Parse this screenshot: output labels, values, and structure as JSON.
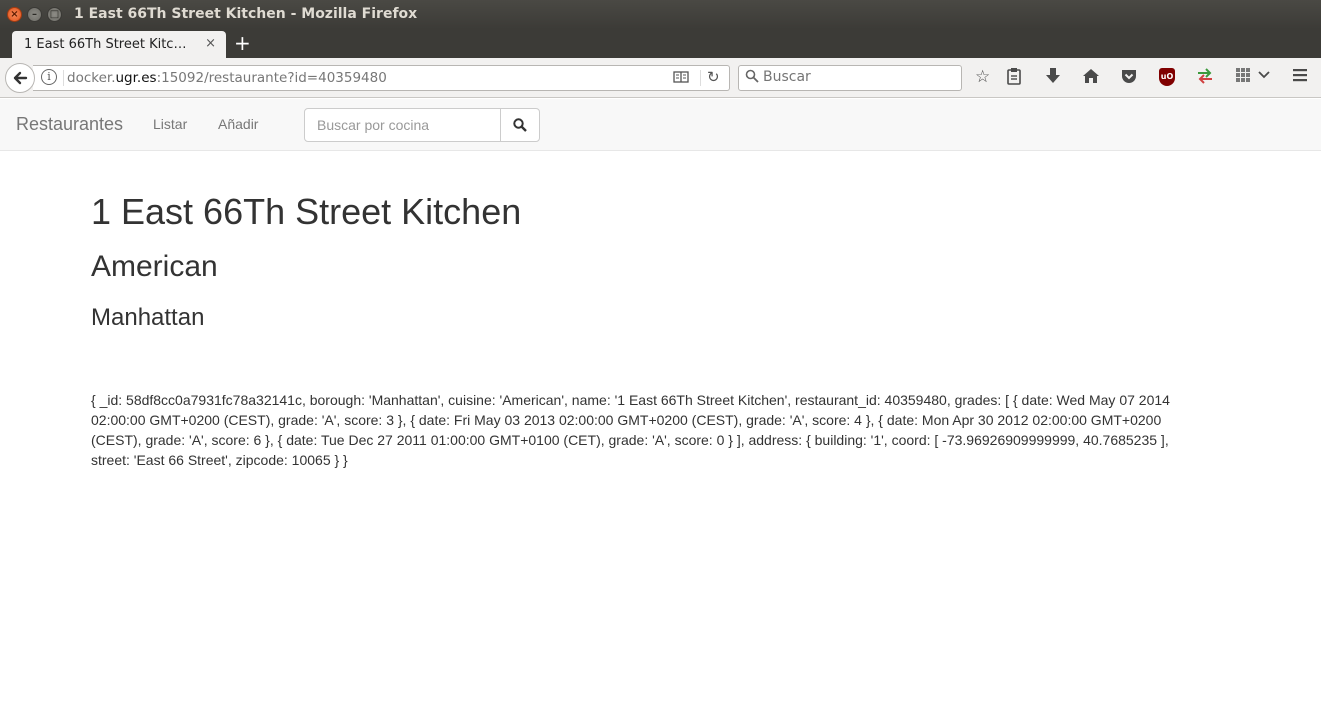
{
  "window": {
    "title": "1 East 66Th Street Kitchen - Mozilla Firefox",
    "close_glyph": "×",
    "min_glyph": "–",
    "max_glyph": "□"
  },
  "tabs": [
    {
      "label": "1 East 66Th Street Kitc…",
      "close_glyph": "×"
    }
  ],
  "new_tab_glyph": "+",
  "urlbar": {
    "prefix": "docker.",
    "host": "ugr.es",
    "rest": ":15092/restaurante?id=40359480"
  },
  "searchbar": {
    "placeholder": "Buscar"
  },
  "toolbar_icons": [
    "star-icon",
    "clipboard-icon",
    "download-icon",
    "home-icon",
    "pocket-icon",
    "ublock-icon",
    "sync-icon",
    "grid-icon",
    "chevron-down-icon",
    "menu-icon"
  ],
  "site": {
    "brand": "Restaurantes",
    "nav": {
      "list": "Listar",
      "add": "Añadir"
    },
    "search_placeholder": "Buscar por cocina"
  },
  "restaurant": {
    "name": "1 East 66Th Street Kitchen",
    "cuisine": "American",
    "borough": "Manhattan",
    "raw": "{ _id: 58df8cc0a7931fc78a32141c, borough: 'Manhattan', cuisine: 'American', name: '1 East 66Th Street Kitchen', restaurant_id: 40359480, grades: [ { date: Wed May 07 2014 02:00:00 GMT+0200 (CEST), grade: 'A', score: 3 }, { date: Fri May 03 2013 02:00:00 GMT+0200 (CEST), grade: 'A', score: 4 }, { date: Mon Apr 30 2012 02:00:00 GMT+0200 (CEST), grade: 'A', score: 6 }, { date: Tue Dec 27 2011 01:00:00 GMT+0100 (CET), grade: 'A', score: 0 } ], address: { building: '1', coord: [ -73.96926909999999, 40.7685235 ], street: 'East 66 Street', zipcode: 10065 } }"
  }
}
